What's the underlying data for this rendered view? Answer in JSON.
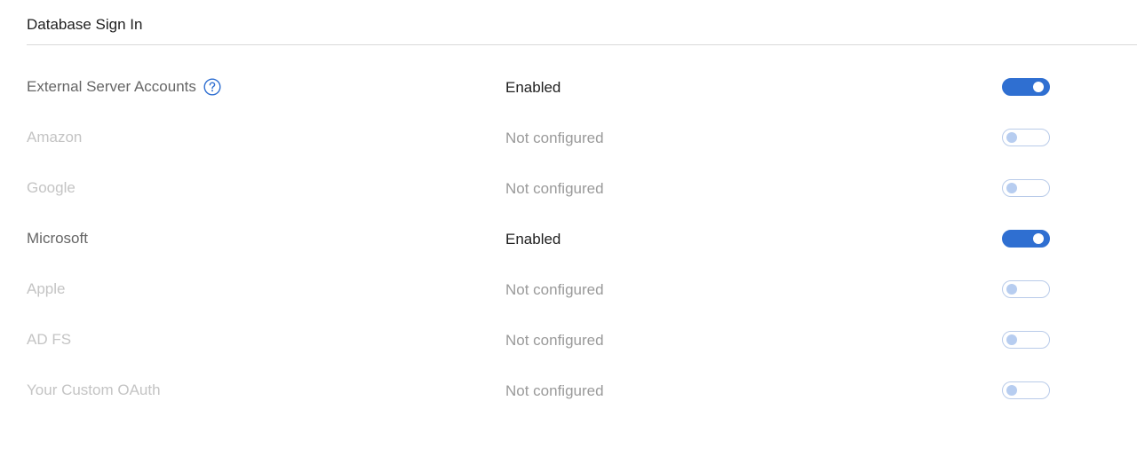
{
  "section": {
    "title": "Database Sign In"
  },
  "rows": [
    {
      "name": "External Server Accounts",
      "status": "Enabled",
      "enabled": true,
      "has_help": true
    },
    {
      "name": "Amazon",
      "status": "Not configured",
      "enabled": false
    },
    {
      "name": "Google",
      "status": "Not configured",
      "enabled": false
    },
    {
      "name": "Microsoft",
      "status": "Enabled",
      "enabled": true
    },
    {
      "name": "Apple",
      "status": "Not configured",
      "enabled": false
    },
    {
      "name": "AD FS",
      "status": "Not configured",
      "enabled": false
    },
    {
      "name": "Your Custom OAuth",
      "status": "Not configured",
      "enabled": false
    }
  ],
  "icons": {
    "help": "help-circle-icon"
  },
  "colors": {
    "accent": "#2f6fd1",
    "toggle_off_border": "#b9cbe9",
    "toggle_off_knob": "#b7cdf0",
    "text_primary": "#1f1f1f",
    "text_muted": "#666666",
    "text_disabled": "#c4c4c4",
    "status_disabled": "#9a9a9a",
    "divider": "#d9d9d9"
  }
}
